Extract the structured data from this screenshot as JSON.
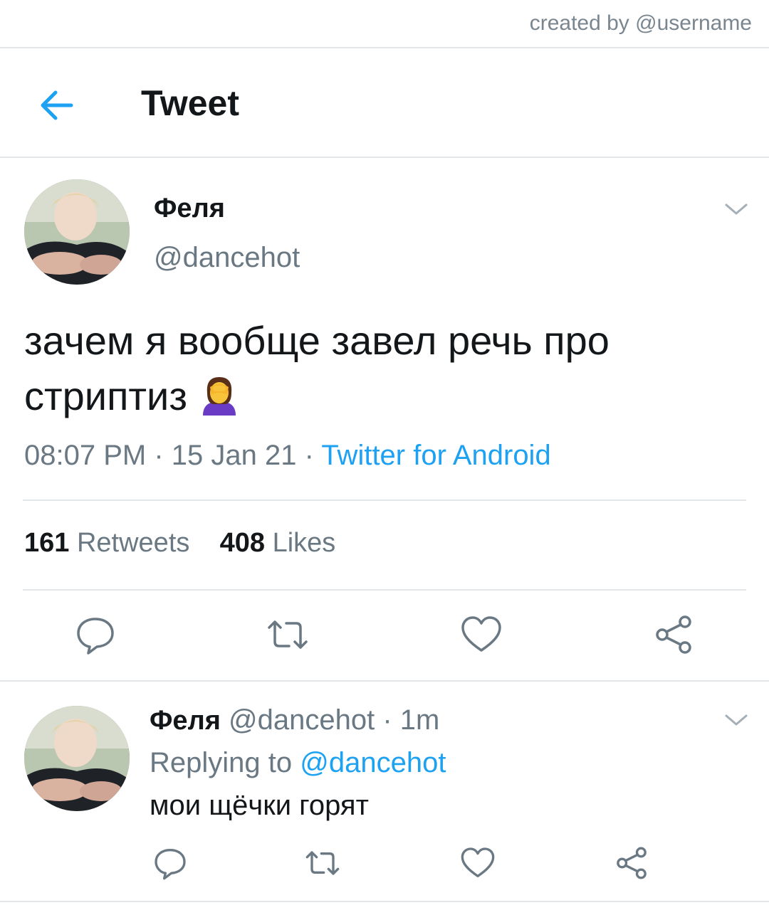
{
  "watermark": "created by @username",
  "header": {
    "title": "Tweet"
  },
  "tweet": {
    "author_name": "Феля",
    "author_handle": "@dancehot",
    "text": "зачем я вообще завел речь про стриптиз",
    "emoji": "woman-facepalming",
    "time": "08:07 PM",
    "date": "15 Jan 21",
    "source": "Twitter for Android",
    "retweets_count": "161",
    "retweets_label": "Retweets",
    "likes_count": "408",
    "likes_label": "Likes"
  },
  "reply": {
    "author_name": "Феля",
    "author_handle": "@dancehot",
    "age": "1m",
    "replying_prefix": "Replying to",
    "replying_handle": "@dancehot",
    "text": "мои щёчки горят"
  },
  "colors": {
    "accent": "#1da1f2",
    "muted": "#697882",
    "divider": "#e3e7ea"
  }
}
